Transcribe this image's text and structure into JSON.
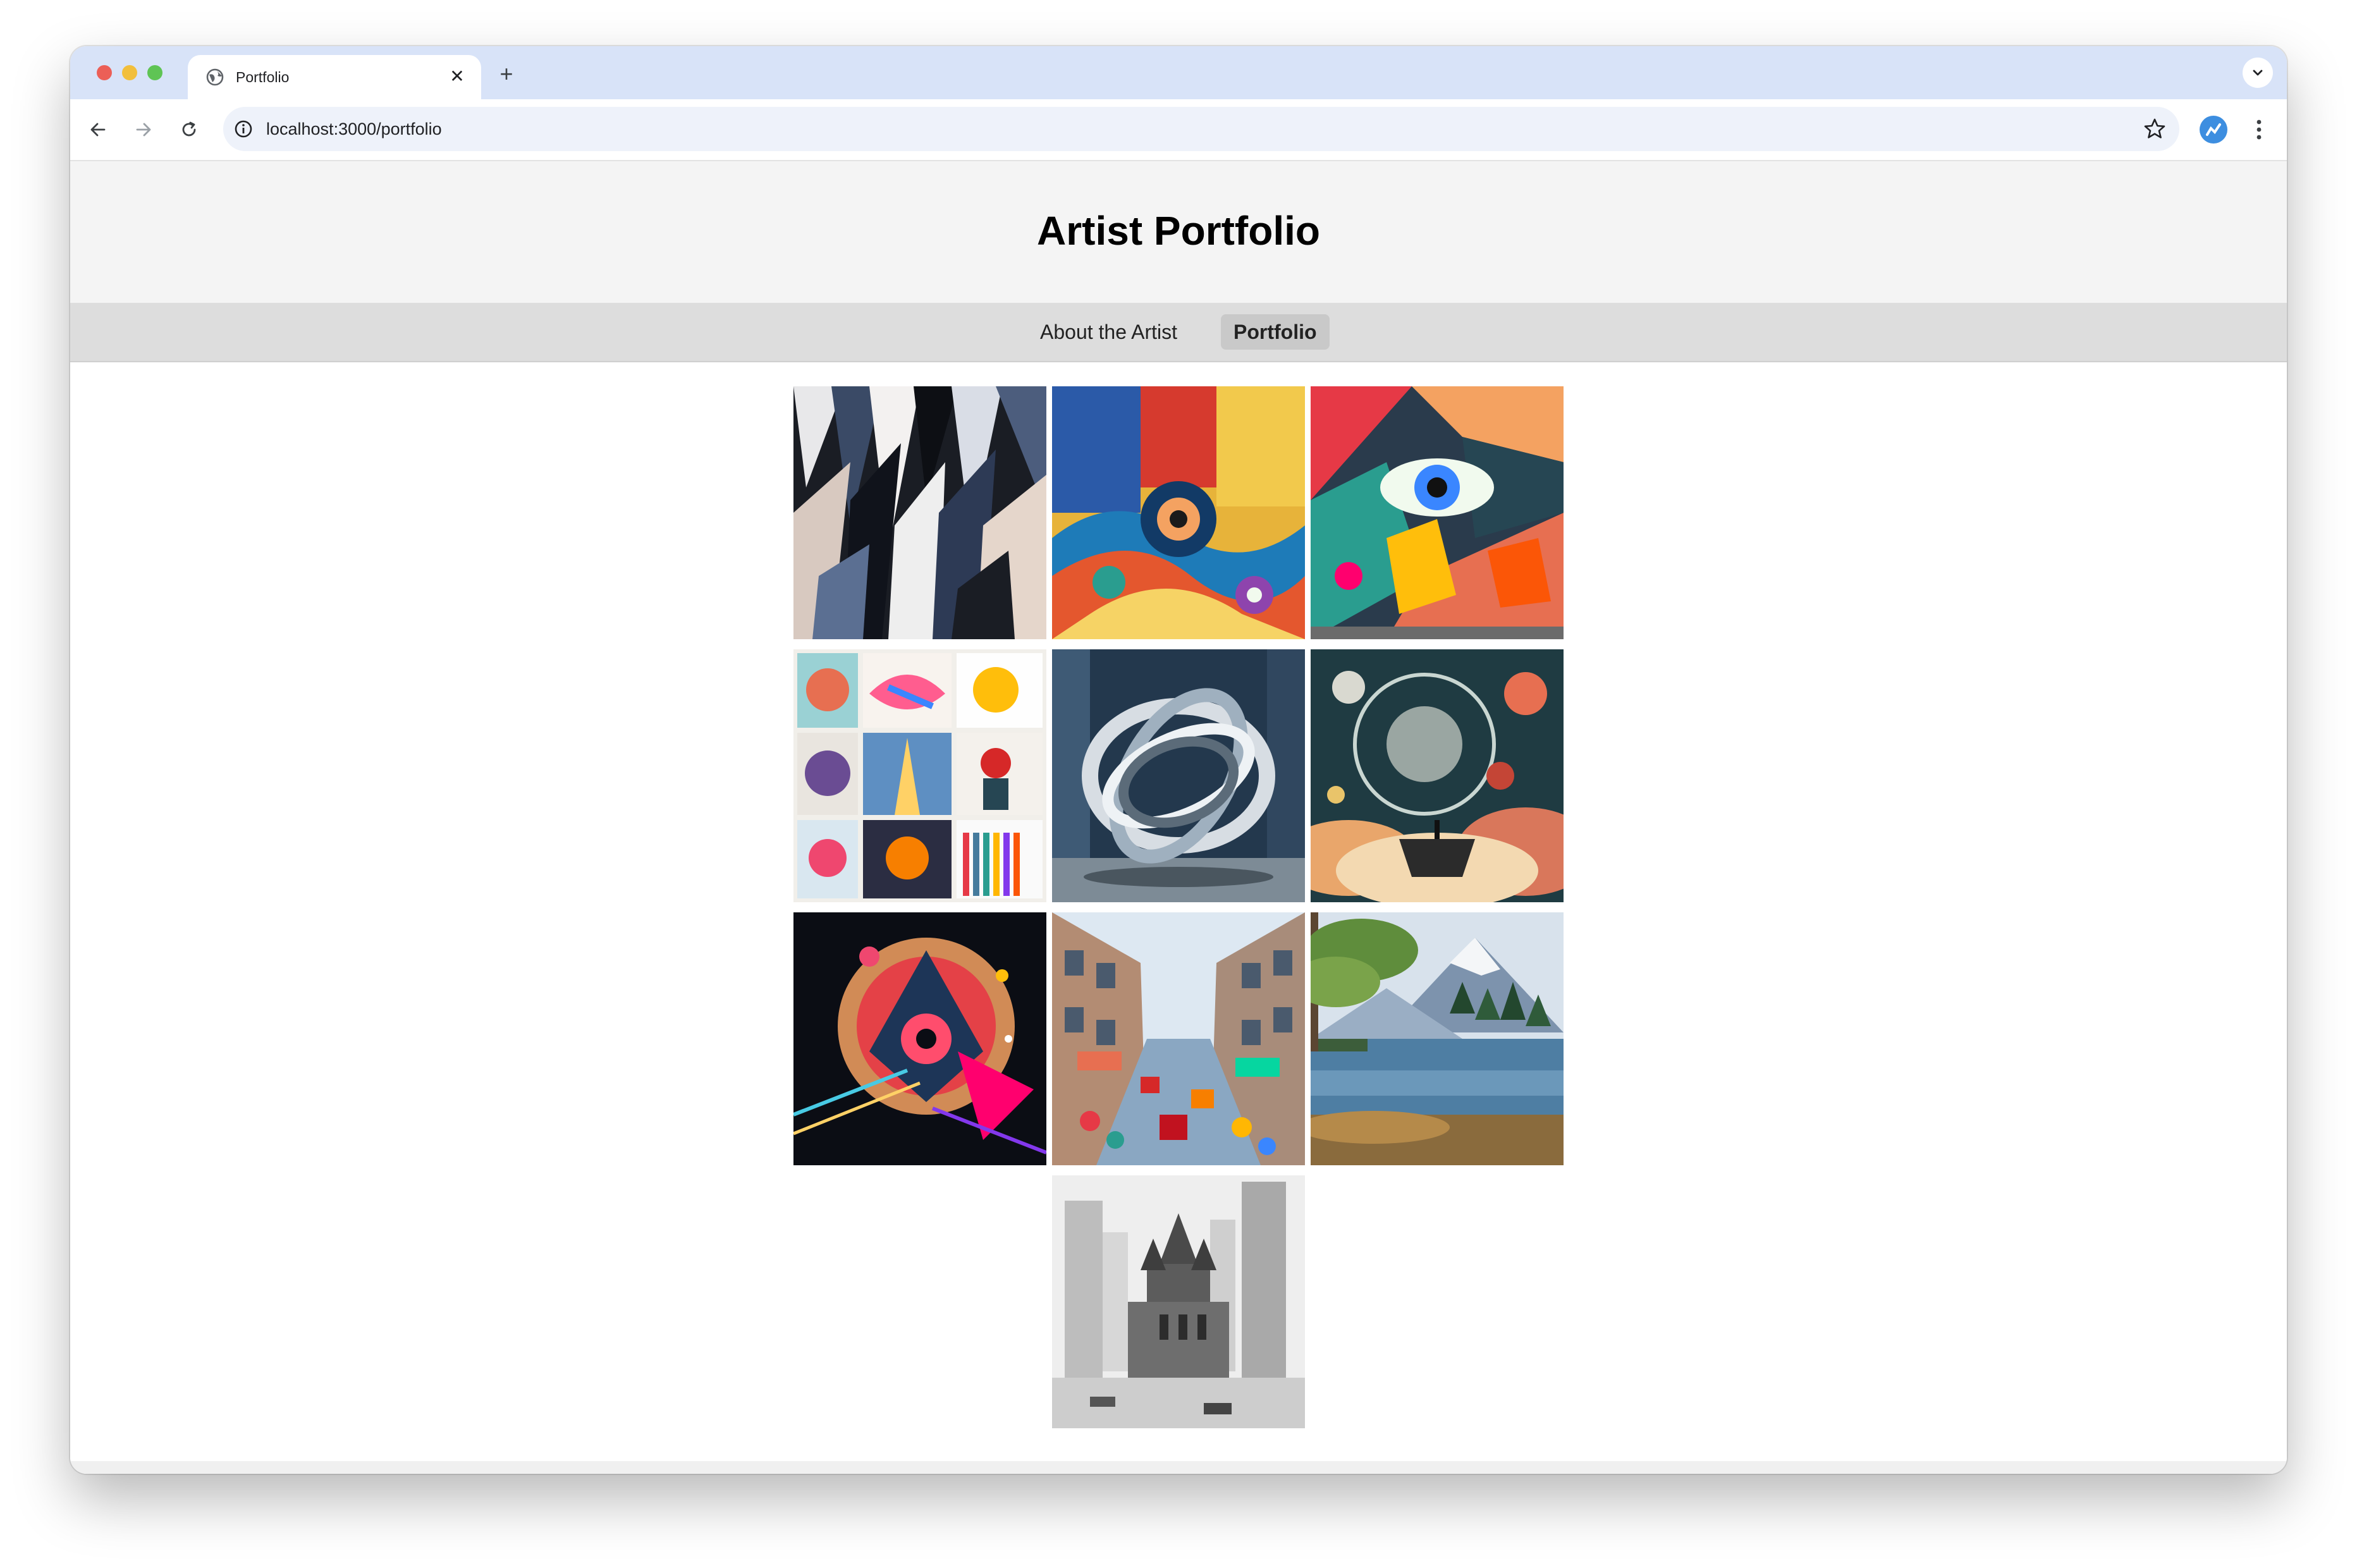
{
  "browser": {
    "tab_title": "Portfolio",
    "tab_close_icon": "close-icon",
    "new_tab_label": "+",
    "url": "localhost:3000/portfolio"
  },
  "header": {
    "title": "Artist Portfolio"
  },
  "nav": {
    "items": [
      {
        "label": "About the Artist",
        "active": false
      },
      {
        "label": "Portfolio",
        "active": true
      }
    ]
  },
  "gallery": {
    "count": 10
  },
  "colors": {
    "tab_strip": "#d8e3f8",
    "header_bg": "#f4f4f4",
    "nav_bg": "#dddddd",
    "active_nav_bg": "#c9c9c9"
  }
}
